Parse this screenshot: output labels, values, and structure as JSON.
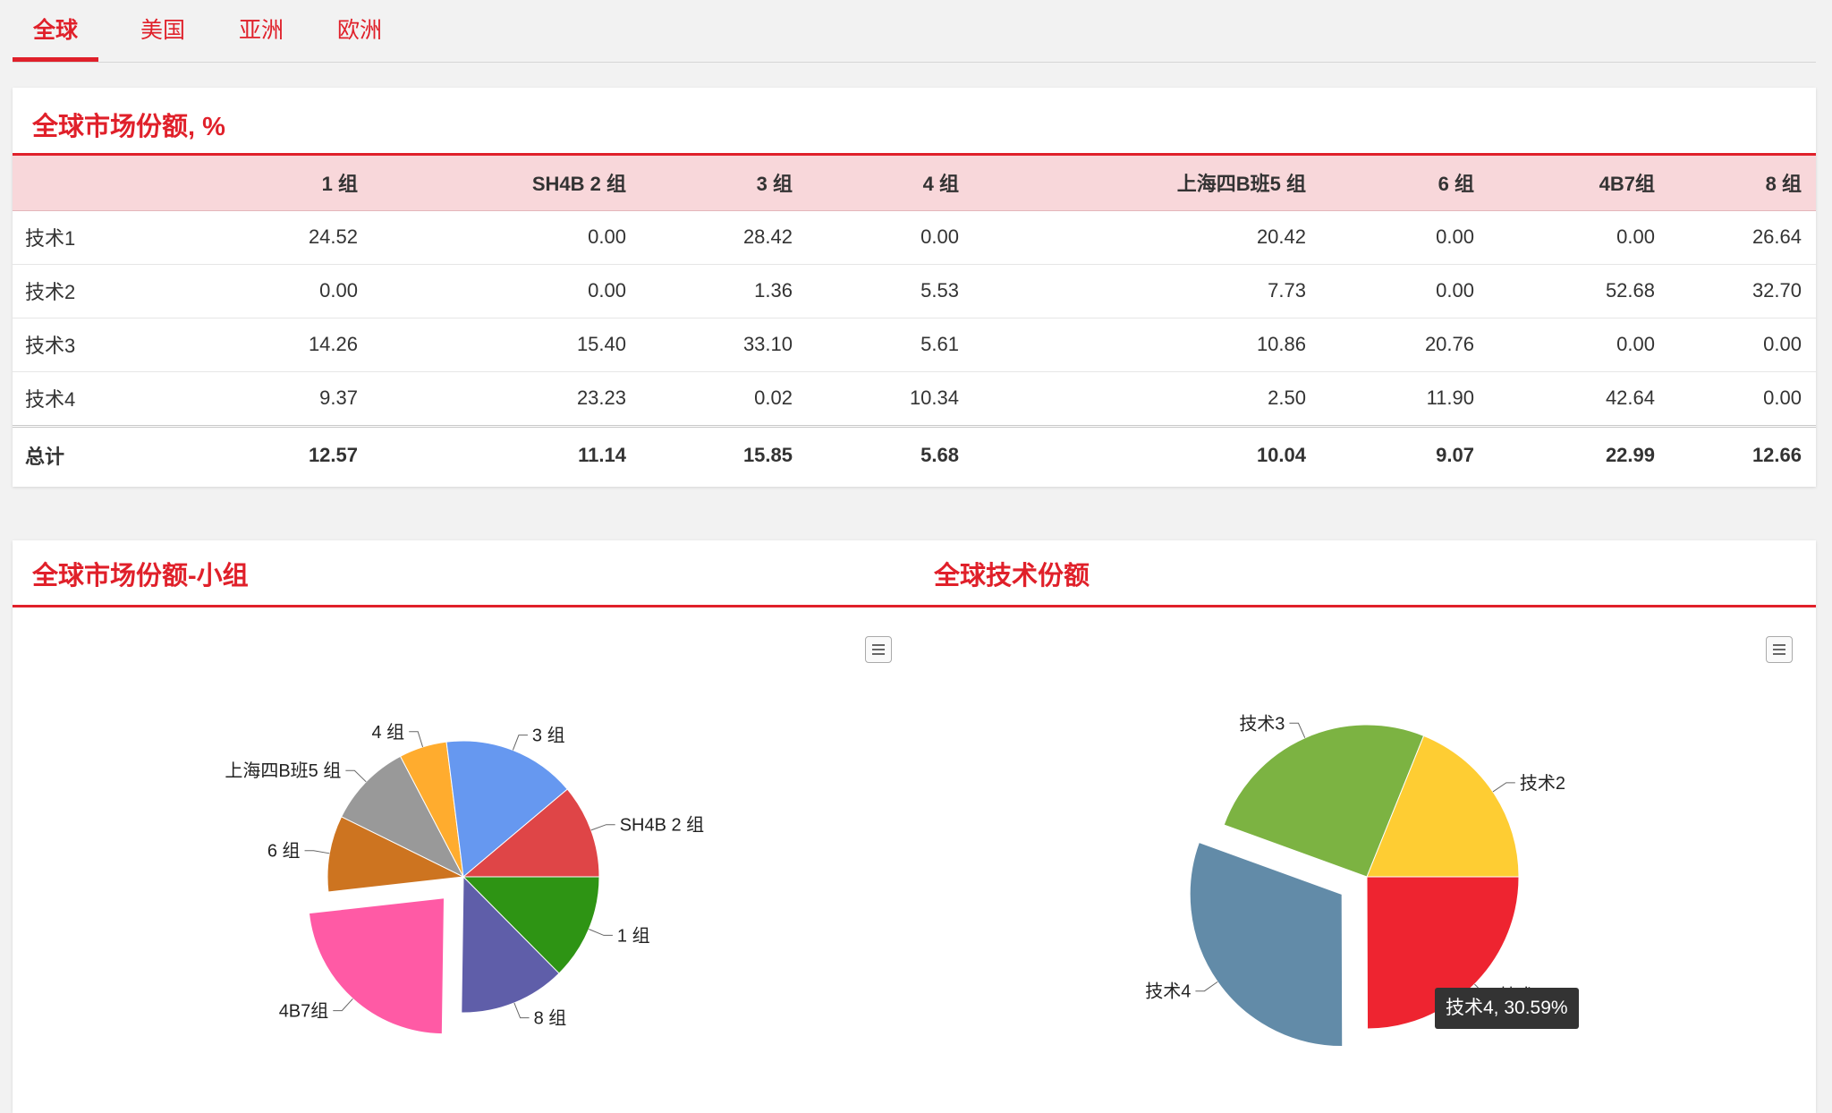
{
  "tabs": [
    "全球",
    "美国",
    "亚洲",
    "欧洲"
  ],
  "share_table": {
    "title": "全球市场份额, %",
    "columns": [
      "",
      "1 组",
      "SH4B 2 组",
      "3 组",
      "4 组",
      "上海四B班5 组",
      "6 组",
      "4B7组",
      "8 组"
    ],
    "rows": [
      [
        "技术1",
        "24.52",
        "0.00",
        "28.42",
        "0.00",
        "20.42",
        "0.00",
        "0.00",
        "26.64"
      ],
      [
        "技术2",
        "0.00",
        "0.00",
        "1.36",
        "5.53",
        "7.73",
        "0.00",
        "52.68",
        "32.70"
      ],
      [
        "技术3",
        "14.26",
        "15.40",
        "33.10",
        "5.61",
        "10.86",
        "20.76",
        "0.00",
        "0.00"
      ],
      [
        "技术4",
        "9.37",
        "23.23",
        "0.02",
        "10.34",
        "2.50",
        "11.90",
        "42.64",
        "0.00"
      ]
    ],
    "total": [
      "总计",
      "12.57",
      "11.14",
      "15.85",
      "5.68",
      "10.04",
      "9.07",
      "22.99",
      "12.66"
    ]
  },
  "charts_card": {
    "left_title": "全球市场份额-小组",
    "right_title": "全球技术份额"
  },
  "chart_data": [
    {
      "type": "pie",
      "title": "全球市场份额-小组",
      "labels": [
        "1 组",
        "8 组",
        "4B7组",
        "6 组",
        "上海四B班5 组",
        "4 组",
        "3 组",
        "SH4B 2 组"
      ],
      "values": [
        12.57,
        12.66,
        22.99,
        9.07,
        10.04,
        5.68,
        15.85,
        11.14
      ],
      "colors": [
        "#2e9414",
        "#5f5ea9",
        "#ff5aa5",
        "#cd7420",
        "#999999",
        "#ffac2e",
        "#6698f0",
        "#df4547"
      ],
      "sliced": "4B7组"
    },
    {
      "type": "pie",
      "title": "全球技术份额",
      "labels": [
        "技术1",
        "技术4",
        "技术3",
        "技术2"
      ],
      "values": [
        24.95,
        30.59,
        25.57,
        18.89
      ],
      "colors": [
        "#ee2430",
        "#628ba8",
        "#7cb342",
        "#fecd33"
      ],
      "sliced": "技术4"
    }
  ],
  "tooltip_text": "技术4, 30.59%"
}
